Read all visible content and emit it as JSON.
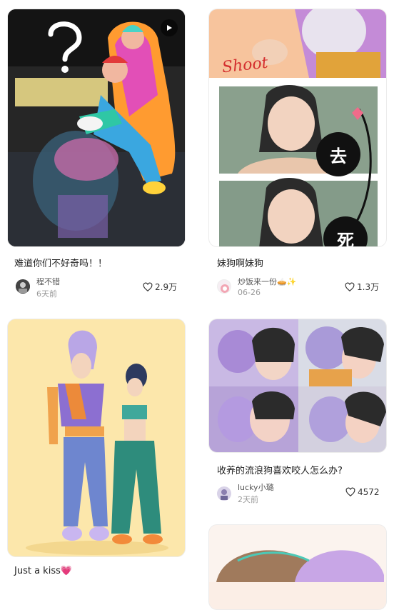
{
  "feed": {
    "cards": [
      {
        "title": "难道你们不好奇吗！！",
        "author": "程不错",
        "date": "6天前",
        "likes": "2.9万",
        "video": true
      },
      {
        "title": "妹狗啊妹狗",
        "author": "炒饭来一份🥧✨",
        "date": "06-26",
        "likes": "1.3万",
        "overlay": {
          "shoot": "Shoot",
          "qu": "去",
          "si": "死"
        }
      },
      {
        "title": "Just a kiss💗",
        "author": "",
        "date": "",
        "likes": ""
      },
      {
        "title": "收养的流浪狗喜欢咬人怎么办?",
        "author": "lucky小璐",
        "date": "2天前",
        "likes": "4572"
      }
    ]
  },
  "colors": {
    "accent": "#ff2442",
    "border": "#ececec"
  },
  "icons": {
    "heart": "heart-icon",
    "play": "play-icon"
  }
}
